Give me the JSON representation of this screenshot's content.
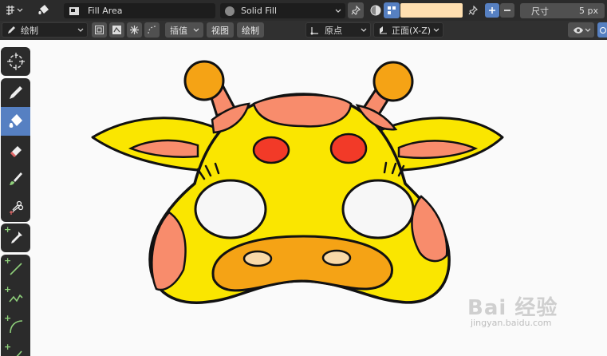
{
  "header": {
    "fill_mode_value": "Fill Area",
    "material_value": "Solid Fill",
    "swatch_color": "#ffdfb0",
    "size_label": "尺寸",
    "size_value": "5 px"
  },
  "toolbar2": {
    "mode_value": "绘制",
    "interp_value": "插值",
    "view_label": "视图",
    "draw_label": "绘制",
    "origin_value": "原点",
    "plane_value": "正面(X-Z)"
  },
  "tools": [
    {
      "name": "cursor-tool",
      "icon": "cursor-icon"
    },
    {
      "name": "draw-tool",
      "icon": "pencil-icon"
    },
    {
      "name": "fill-tool",
      "icon": "bucket-icon"
    },
    {
      "name": "erase-tool",
      "icon": "eraser-icon"
    },
    {
      "name": "tint-tool",
      "icon": "brush-icon"
    },
    {
      "name": "cutter-tool",
      "icon": "scissors-icon"
    },
    {
      "name": "eyedropper-tool",
      "icon": "eyedropper-icon"
    },
    {
      "name": "line-tool",
      "icon": "line-icon"
    },
    {
      "name": "polyline-tool",
      "icon": "polyline-icon"
    },
    {
      "name": "arc-tool",
      "icon": "arc-icon"
    },
    {
      "name": "curve-tool",
      "icon": "curve-icon"
    }
  ],
  "colors": {
    "accent": "#5680c2",
    "mask_yellow": "#fae600",
    "mask_salmon": "#f88c6c",
    "mask_orange": "#f5a315",
    "nose_red": "#f23a28",
    "nostril": "#f9d9a8",
    "eye_white": "#f7f7f7"
  },
  "watermark": {
    "brand": "Bai 经验",
    "url": "jingyan.baidu.com"
  }
}
